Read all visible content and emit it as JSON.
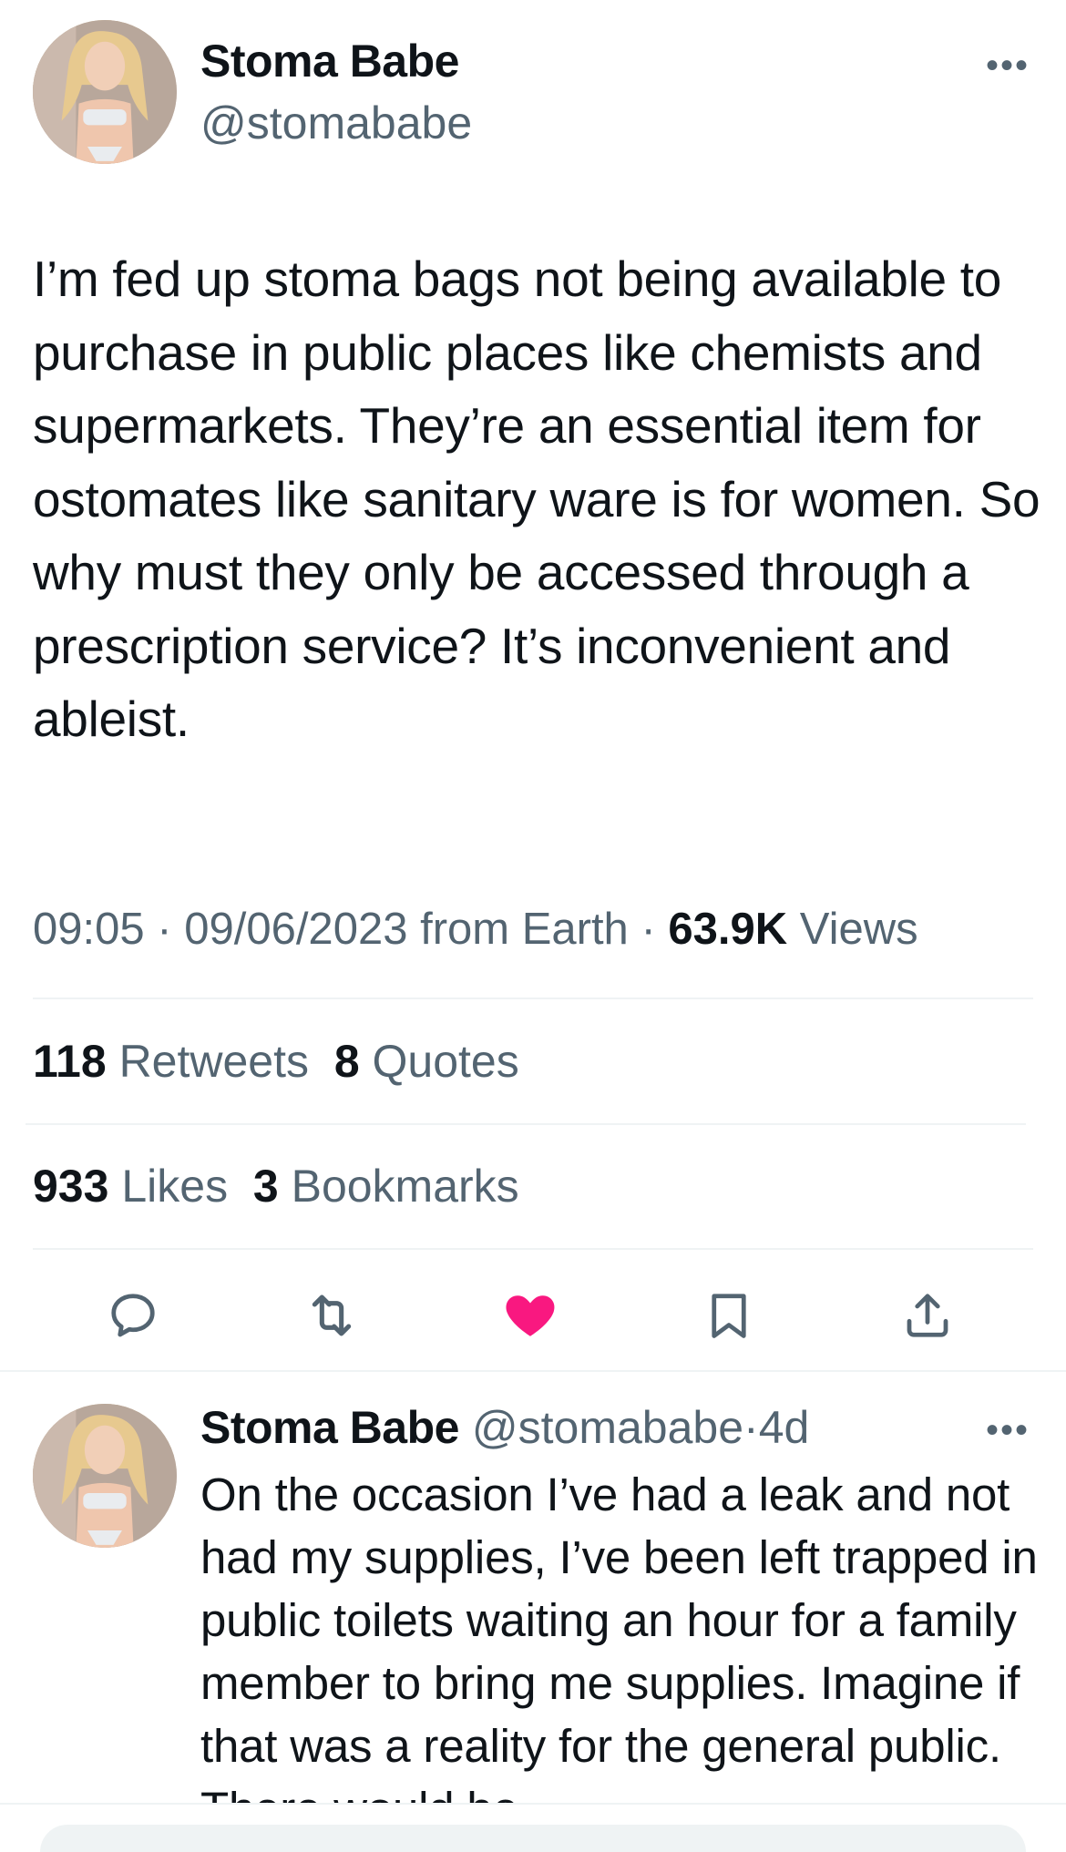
{
  "main_tweet": {
    "display_name": "Stoma Babe",
    "handle": "@stomababe",
    "more_label": "•••",
    "text": "I’m fed up stoma bags not being available to purchase in public places like chemists and supermarkets. They’re an essential item for ostomates like sanitary ware is for women. So why must they only be accessed through a prescription service? It’s inconvenient and ableist.",
    "time": "09:05",
    "date": "09/06/2023",
    "source": "from Earth",
    "separator": "·",
    "views_count": "63.9K",
    "views_label": "Views",
    "retweets_count": "118",
    "retweets_label": "Retweets",
    "quotes_count": "8",
    "quotes_label": "Quotes",
    "likes_count": "933",
    "likes_label": "Likes",
    "bookmarks_count": "3",
    "bookmarks_label": "Bookmarks"
  },
  "actions": [
    {
      "icon": "reply-icon"
    },
    {
      "icon": "retweet-icon"
    },
    {
      "icon": "heart-filled-icon",
      "color": "#f91880"
    },
    {
      "icon": "bookmark-icon"
    },
    {
      "icon": "share-icon"
    }
  ],
  "reply": {
    "display_name": "Stoma Babe",
    "handle": "@stomababe",
    "separator": "·",
    "age": "4d",
    "more_label": "•••",
    "text": "On the occasion I’ve had a leak and not had my supplies, I’ve been left trapped in public toilets waiting an hour for a family member to bring me supplies. Imagine if that was a reality for the general public. There would be"
  },
  "colors": {
    "text": "#0f1419",
    "secondary": "#536471",
    "divider": "#eff3f4",
    "like": "#f91880"
  }
}
